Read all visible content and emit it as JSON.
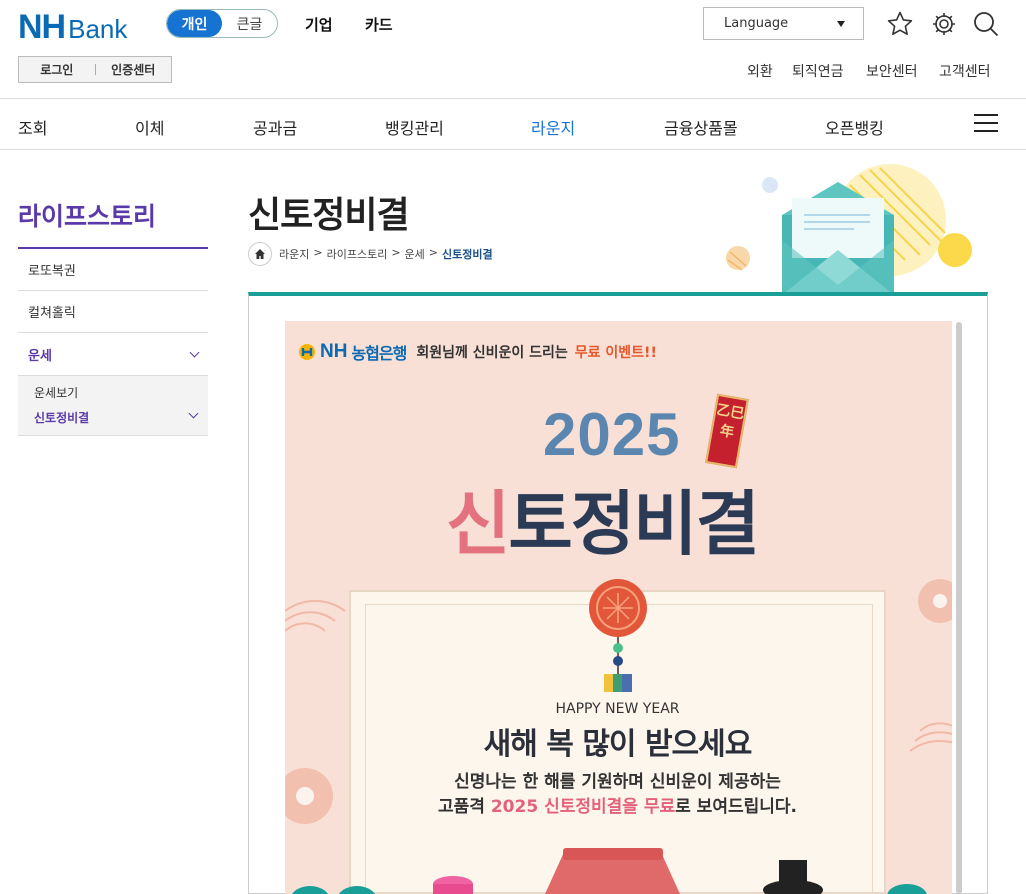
{
  "brand": {
    "logo_nh": "NH",
    "logo_bank": "Bank"
  },
  "mode_toggle": {
    "personal": "개인",
    "large_text": "큰글"
  },
  "top_nav": [
    "기업",
    "카드"
  ],
  "language": {
    "label": "Language"
  },
  "login": {
    "login_label": "로그인",
    "cert_label": "인증센터"
  },
  "utility_links": [
    "외환",
    "퇴직연금",
    "보안센터",
    "고객센터"
  ],
  "gnb": [
    "조회",
    "이체",
    "공과금",
    "뱅킹관리",
    "라운지",
    "금융상품몰",
    "오픈뱅킹"
  ],
  "gnb_active": "라운지",
  "sidebar": {
    "title": "라이프스토리",
    "items": [
      "로또복권",
      "컬쳐홀릭",
      "운세"
    ],
    "subitems": [
      "운세보기",
      "신토정비결"
    ]
  },
  "page": {
    "title": "신토정비결",
    "breadcrumb": [
      "라운지",
      "라이프스토리",
      "운세",
      "신토정비결"
    ]
  },
  "poster": {
    "bank_mark": "NH",
    "bank_name": "농협은행",
    "promo_text": "회원님께 신비운이 드리는",
    "promo_highlight": "무료 이벤트!!",
    "year": "2025",
    "seal_text": "乙巳年",
    "headline_first": "신",
    "headline_rest": "토정비결",
    "greeting_en": "HAPPY NEW YEAR",
    "greeting_ko": "새해 복 많이 받으세요",
    "desc_line1": "신명나는 한 해를 기원하며 신비운이 제공하는",
    "desc_line2_a": "고품격 ",
    "desc_line2_hl": "2025 신토정비결을 무료",
    "desc_line2_b": "로 보여드립니다."
  },
  "colors": {
    "brand_blue": "#0a6ab3",
    "accent_purple": "#5a3aa8",
    "teal": "#1a9e98",
    "poster_bg": "#f8e0d6"
  }
}
